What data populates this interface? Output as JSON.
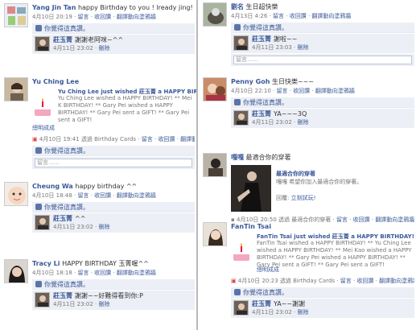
{
  "colors": {
    "link": "#3b5998",
    "panel": "#eceff5",
    "meta": "#777777"
  },
  "left": {
    "story1": {
      "actor": "Yang Jin Tan",
      "message": "happy Birthday to you ! lready jing!",
      "date": "4月10日",
      "time": "20:19",
      "comment_action": "留言",
      "unlike_action": "收回讚",
      "share_action": "翻譯動向塗鴉牆",
      "likes_text": "你覺得這真讚。",
      "comment": {
        "name": "莊玉菁",
        "text": "謝謝老阿咪~^^",
        "date": "4月11日",
        "time": "23:02",
        "delete": "刪除"
      }
    },
    "story2": {
      "actor": "Yu Ching Lee",
      "attach_title": "Yu Ching Lee just wished 莊玉菁 a HAPPY BIR",
      "attach_desc": "Yu Ching Lee wished a HAPPY BIRTHDAY! ** Mei K BIRTHDAY! ** Gary Pei wished a HAPPY BIRTHDAY! ** Gary Pei sent a GIFT! ** Gary Pei sent a GIFT!",
      "attach_link": "總明成成",
      "date": "4月10日",
      "time": "19:41",
      "via_sep": "透過",
      "app": "Birthday Cards",
      "comment_action": "留言",
      "unlike_action": "收回讚",
      "share_action": "翻譯動向塗鴉牆",
      "likes_text": "你覺得這真讚。",
      "add_comment": "留言……"
    },
    "story3": {
      "actor": "Cheung Wa",
      "message": "happy birthday ^^",
      "date": "4月10日",
      "time": "18:48",
      "comment_action": "留言",
      "unlike_action": "收回讚",
      "share_action": "翻譯動向塗鴉牆",
      "likes_text": "你覺得這真讚。",
      "comment": {
        "name": "莊玉菁",
        "text": "^^",
        "date": "4月11日",
        "time": "23:02",
        "delete": "刪除"
      }
    },
    "story4": {
      "actor": "Tracy Li",
      "message": "HAPPY BIRTHDAY 玉菁喔^^",
      "date": "4月10日",
      "time": "18:18",
      "comment_action": "留言",
      "unlike_action": "收回讚",
      "share_action": "翻譯動向塗鴉牆",
      "likes_text": "你覺得這真讚。",
      "comment": {
        "name": "莊玉菁",
        "text": "謝謝~~好難得看到你:P",
        "date": "4月11日",
        "time": "23:02",
        "delete": "刪除"
      }
    }
  },
  "right": {
    "story1": {
      "actor": "劉名",
      "message": "生日超快樂",
      "date": "4月13日",
      "time": "4:26",
      "comment_action": "留言",
      "unlike_action": "收回讚",
      "share_action": "翻譯動向塗鴉牆",
      "likes_text": "你覺得這真讚。",
      "comment": {
        "name": "莊玉菁",
        "text": "謝啦~~",
        "date": "4月11日",
        "time": "23:03",
        "delete": "刪除"
      },
      "add_comment": "留言……"
    },
    "story2": {
      "actor": "Penny Goh",
      "message": "生日快樂~~~",
      "date": "4月10日",
      "time": "22:10",
      "comment_action": "留言",
      "unlike_action": "收回讚",
      "share_action": "翻譯動向塗鴉牆",
      "likes_text": "你覺得這真讚。",
      "comment": {
        "name": "莊玉菁",
        "text": "YA~~~3Q",
        "date": "4月11日",
        "time": "23:02",
        "delete": "刪除"
      }
    },
    "story3": {
      "actor": "嘎嘎",
      "message": "最適合你的穿著",
      "photo_title": "最適合你的穿著",
      "photo_desc": "嘎嘎 希望你加入最適合你的穿著。",
      "photo_reply": "回覆:",
      "photo_link": "立刻試玩!",
      "date": "4月10日",
      "time": "20:50",
      "via_sep": "透過",
      "app": "最適合你的穿著",
      "comment_action": "留言",
      "unlike_action": "收回讚",
      "share_action": "翻譯動向塗鴉牆"
    },
    "story4": {
      "actor": "FanTin Tsai",
      "attach_title": "FanTin Tsai just wished 莊玉菁 a HAPPY BIRTHDAY!",
      "attach_desc": "FanTin Tsai wished a HAPPY BIRTHDAY! ** Yu Ching Lee wished a HAPPY BIRTHDAY! ** Mei Kao wished a HAPPY BIRTHDAY! ** Gary Pei wished a HAPPY BIRTHDAY! ** Gary Pei sent a GIFT! ** Gary Pei sent a GIFT!",
      "attach_link": "總明成成",
      "date": "4月10日",
      "time": "20:23",
      "via_sep": "透過",
      "app": "Birthday Cards",
      "comment_action": "留言",
      "unlike_action": "收回讚",
      "share_action": "翻譯動向塗鴉牆",
      "likes_text": "你覺得這真讚。",
      "comment": {
        "name": "莊玉菁",
        "text": "YA~~謝謝",
        "date": "4月11日",
        "time": "23:02",
        "delete": "刪除"
      }
    }
  }
}
